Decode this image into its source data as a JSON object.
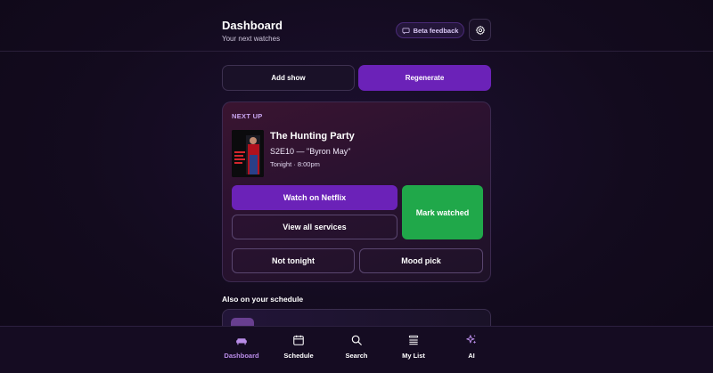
{
  "header": {
    "title": "Dashboard",
    "subtitle": "Your next watches",
    "beta_feedback_label": "Beta feedback"
  },
  "actions": {
    "add_show_label": "Add show",
    "regenerate_label": "Regenerate"
  },
  "next_up": {
    "label": "NEXT UP",
    "show_title": "The Hunting Party",
    "episode": "S2E10 — \"Byron May\"",
    "air_time": "Tonight · 8:00pm",
    "poster_text": "THE HUNTING PARTY",
    "watch_label": "Watch on Netflix",
    "view_services_label": "View all services",
    "mark_watched_label": "Mark watched",
    "not_tonight_label": "Not tonight",
    "mood_pick_label": "Mood pick"
  },
  "schedule": {
    "title": "Also on your schedule"
  },
  "nav": {
    "items": [
      {
        "label": "Dashboard",
        "icon": "sofa-icon",
        "active": true
      },
      {
        "label": "Schedule",
        "icon": "calendar-icon",
        "active": false
      },
      {
        "label": "Search",
        "icon": "search-icon",
        "active": false
      },
      {
        "label": "My List",
        "icon": "list-icon",
        "active": false
      },
      {
        "label": "AI",
        "icon": "sparkles-icon",
        "active": false
      }
    ]
  },
  "colors": {
    "accent": "#6b22b8",
    "success": "#20a84a",
    "background": "#120a1c",
    "active_nav": "#b98ce8"
  }
}
